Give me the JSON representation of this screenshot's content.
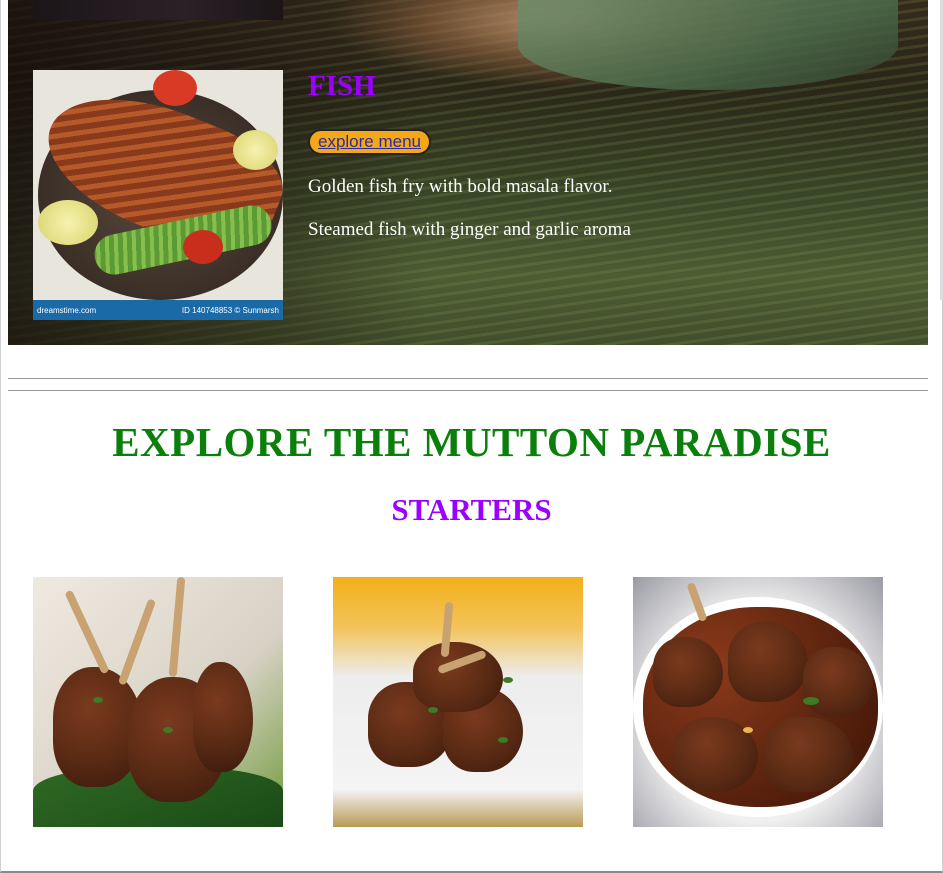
{
  "hero": {
    "section_title": "FISH",
    "button_label": "explore menu",
    "descriptions": [
      "Golden fish fry with bold masala flavor.",
      "Steamed fish with ginger and garlic aroma"
    ],
    "image_watermark_left": "dreamstime.com",
    "image_watermark_right": "ID 140748853 © Sunmarsh"
  },
  "mutton": {
    "heading": "EXPLORE THE MUTTON PARADISE",
    "subheading": "STARTERS"
  },
  "colors": {
    "section_title": "#9b00ff",
    "mutton_heading": "#0b7f0b",
    "button_bg": "#f4a717",
    "button_text": "#2c2c9e"
  }
}
